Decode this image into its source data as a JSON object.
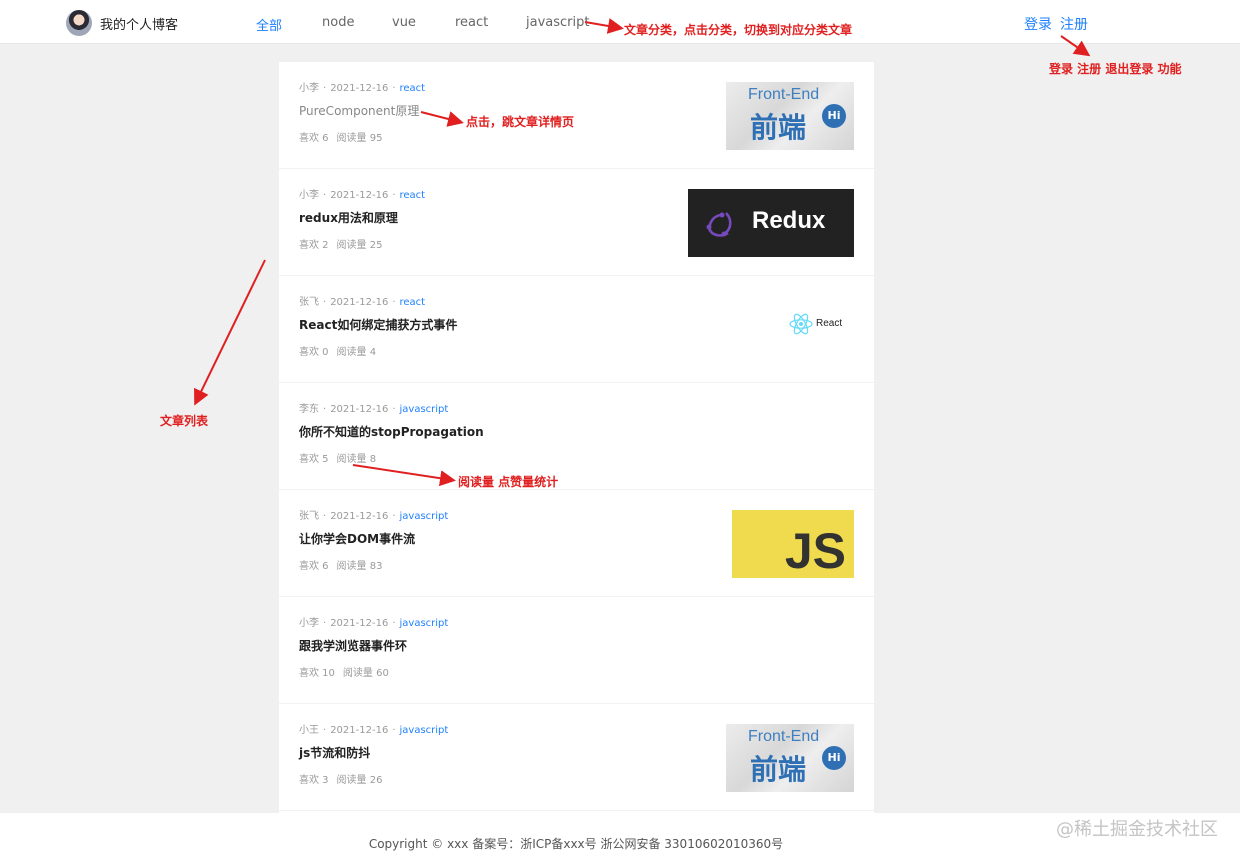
{
  "header": {
    "site_title": "我的个人博客",
    "nav": [
      {
        "label": "全部",
        "active": true
      },
      {
        "label": "node",
        "active": false
      },
      {
        "label": "vue",
        "active": false
      },
      {
        "label": "react",
        "active": false
      },
      {
        "label": "javascript",
        "active": false
      }
    ],
    "login": "登录",
    "register": "注册"
  },
  "annotations": {
    "category": "文章分类，点击分类，切换到对应分类文章",
    "auth": "登录 注册 退出登录 功能",
    "click_detail": "点击，跳文章详情页",
    "article_list": "文章列表",
    "stats": "阅读量 点赞量统计"
  },
  "articles": [
    {
      "author": "小李",
      "date": "2021-12-16",
      "category": "react",
      "title": "PureComponent原理",
      "likes": "喜欢 6",
      "views": "阅读量 95",
      "thumb": "front-end"
    },
    {
      "author": "小李",
      "date": "2021-12-16",
      "category": "react",
      "title": "redux用法和原理",
      "likes": "喜欢 2",
      "views": "阅读量 25",
      "thumb": "redux"
    },
    {
      "author": "张飞",
      "date": "2021-12-16",
      "category": "react",
      "title": "React如何绑定捕获方式事件",
      "likes": "喜欢 0",
      "views": "阅读量 4",
      "thumb": "react"
    },
    {
      "author": "李东",
      "date": "2021-12-16",
      "category": "javascript",
      "title": "你所不知道的stopPropagation",
      "likes": "喜欢 5",
      "views": "阅读量 8",
      "thumb": "none"
    },
    {
      "author": "张飞",
      "date": "2021-12-16",
      "category": "javascript",
      "title": "让你学会DOM事件流",
      "likes": "喜欢 6",
      "views": "阅读量 83",
      "thumb": "js"
    },
    {
      "author": "小李",
      "date": "2021-12-16",
      "category": "javascript",
      "title": "跟我学浏览器事件环",
      "likes": "喜欢 10",
      "views": "阅读量 60",
      "thumb": "none"
    },
    {
      "author": "小王",
      "date": "2021-12-16",
      "category": "javascript",
      "title": "js节流和防抖",
      "likes": "喜欢 3",
      "views": "阅读量 26",
      "thumb": "front-end"
    }
  ],
  "thumbs": {
    "front_end_en": "Front-End",
    "front_end_cn": "前端",
    "front_end_hi": "Hi",
    "redux": "Redux",
    "react": "React",
    "js": "JS"
  },
  "footer": {
    "copyright": "Copyright © xxx 备案号：浙ICP备xxx号 浙公网安备 33010602010360号",
    "watermark": "@稀土掘金技术社区"
  },
  "colors": {
    "accent": "#1e80ff",
    "annotation": "#e02020",
    "background": "#f0f0f0"
  }
}
